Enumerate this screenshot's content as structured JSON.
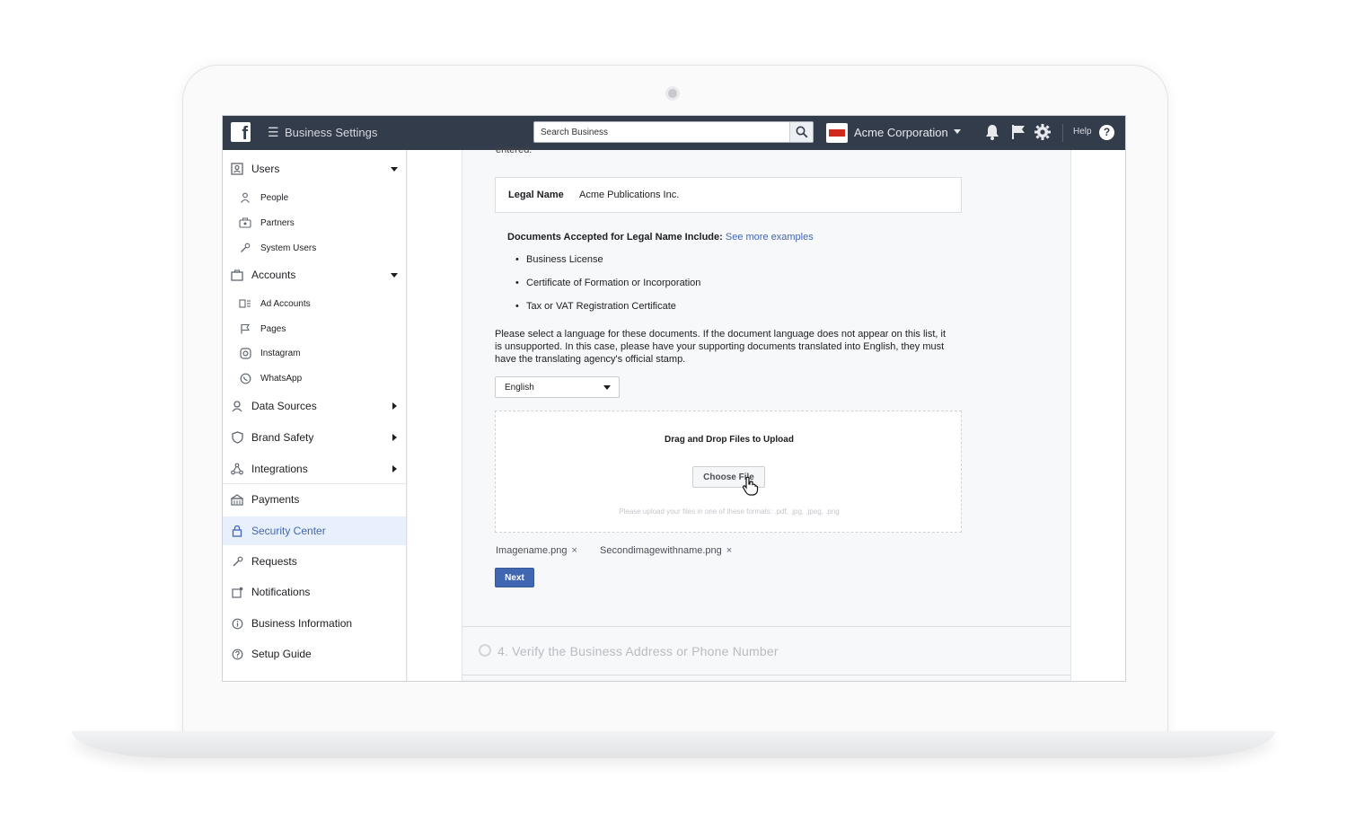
{
  "topbar": {
    "logo_letter": "f",
    "title": "Business Settings",
    "search_placeholder": "Search Business",
    "business_name": "Acme Corporation",
    "help_label": "Help",
    "help_glyph": "?"
  },
  "sidebar": {
    "users": {
      "label": "Users",
      "items": [
        "People",
        "Partners",
        "System Users"
      ]
    },
    "accounts": {
      "label": "Accounts",
      "items": [
        "Ad Accounts",
        "Pages",
        "Instagram",
        "WhatsApp"
      ]
    },
    "data_sources": "Data Sources",
    "brand_safety": "Brand Safety",
    "integrations": "Integrations",
    "payments": "Payments",
    "security_center": "Security Center",
    "requests": "Requests",
    "notifications": "Notifications",
    "business_information": "Business Information",
    "setup_guide": "Setup Guide",
    "active_color": "#4267b2"
  },
  "content": {
    "cut_text": "entered:",
    "legal_key": "Legal Name",
    "legal_value": "Acme Publications Inc.",
    "docs_title": "Documents Accepted for Legal Name Include:",
    "docs_link": "See more examples",
    "documents": [
      "Business License",
      "Certificate of Formation or Incorporation",
      "Tax or VAT Registration Certificate"
    ],
    "language_note": "Please select a language for these documents. If the document language does not appear on this list, it is unsupported. In this case, please have your supporting documents translated into English, they must have the translating agency's official stamp.",
    "language_selected": "English",
    "dropzone_title": "Drag and Drop Files to Upload",
    "choose_file_label": "Choose File",
    "dropzone_hint": "Please upload your files in one of these formats: .pdf, .jpg, .jpeg, .png",
    "files": [
      "Imagename.png",
      "Secondimagewithname.png"
    ],
    "remove_glyph": "×",
    "next_label": "Next",
    "next_step_label": "4. Verify the Business Address or Phone Number"
  },
  "colors": {
    "topbar_bg": "#333c4a",
    "primary_blue": "#4267b2"
  }
}
